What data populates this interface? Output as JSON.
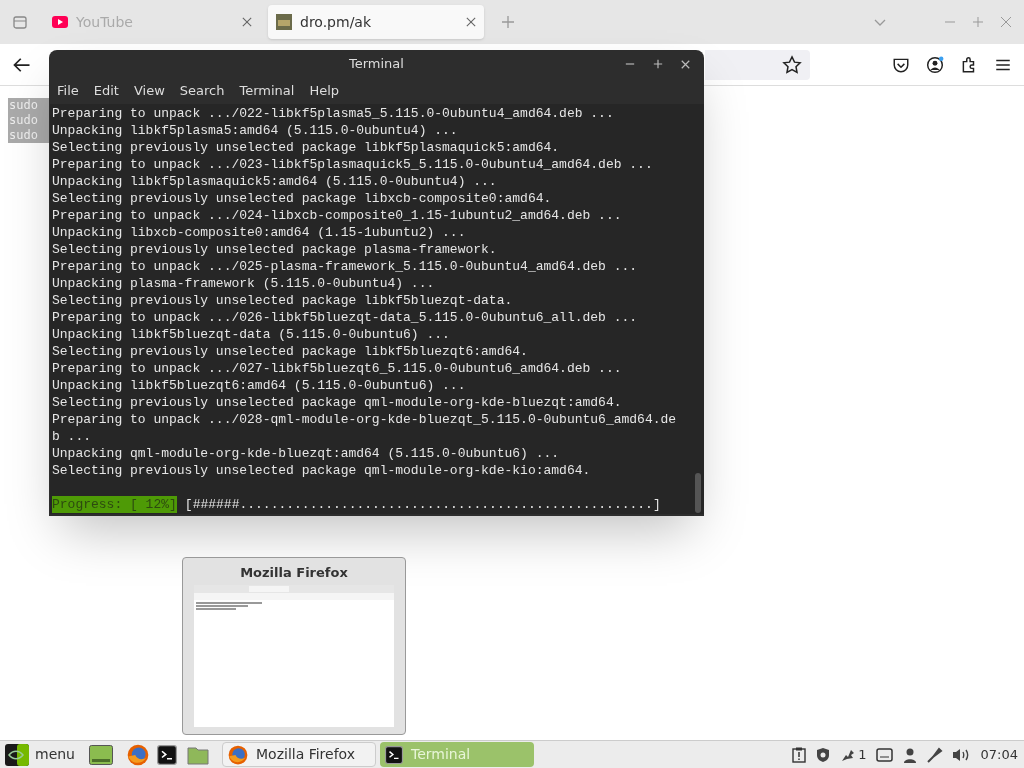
{
  "browser": {
    "tabs": [
      {
        "label": "YouTube",
        "selected": false
      },
      {
        "label": "dro.pm/ak",
        "selected": true
      }
    ],
    "page_lines": [
      "sudo",
      "sudo",
      "sudo"
    ]
  },
  "terminal": {
    "title": "Terminal",
    "menu": [
      "File",
      "Edit",
      "View",
      "Search",
      "Terminal",
      "Help"
    ],
    "lines": [
      "Preparing to unpack .../022-libkf5plasma5_5.115.0-0ubuntu4_amd64.deb ...",
      "Unpacking libkf5plasma5:amd64 (5.115.0-0ubuntu4) ...",
      "Selecting previously unselected package libkf5plasmaquick5:amd64.",
      "Preparing to unpack .../023-libkf5plasmaquick5_5.115.0-0ubuntu4_amd64.deb ...",
      "Unpacking libkf5plasmaquick5:amd64 (5.115.0-0ubuntu4) ...",
      "Selecting previously unselected package libxcb-composite0:amd64.",
      "Preparing to unpack .../024-libxcb-composite0_1.15-1ubuntu2_amd64.deb ...",
      "Unpacking libxcb-composite0:amd64 (1.15-1ubuntu2) ...",
      "Selecting previously unselected package plasma-framework.",
      "Preparing to unpack .../025-plasma-framework_5.115.0-0ubuntu4_amd64.deb ...",
      "Unpacking plasma-framework (5.115.0-0ubuntu4) ...",
      "Selecting previously unselected package libkf5bluezqt-data.",
      "Preparing to unpack .../026-libkf5bluezqt-data_5.115.0-0ubuntu6_all.deb ...",
      "Unpacking libkf5bluezqt-data (5.115.0-0ubuntu6) ...",
      "Selecting previously unselected package libkf5bluezqt6:amd64.",
      "Preparing to unpack .../027-libkf5bluezqt6_5.115.0-0ubuntu6_amd64.deb ...",
      "Unpacking libkf5bluezqt6:amd64 (5.115.0-0ubuntu6) ...",
      "Selecting previously unselected package qml-module-org-kde-bluezqt:amd64.",
      "Preparing to unpack .../028-qml-module-org-kde-bluezqt_5.115.0-0ubuntu6_amd64.de",
      "b ...",
      "Unpacking qml-module-org-kde-bluezqt:amd64 (5.115.0-0ubuntu6) ...",
      "Selecting previously unselected package qml-module-org-kde-kio:amd64."
    ],
    "progress_label": "Progress: [ 12%]",
    "progress_bar": "[######.....................................................]"
  },
  "preview": {
    "title": "Mozilla Firefox"
  },
  "taskbar": {
    "menu_label": "menu",
    "windows": [
      {
        "kind": "firefox",
        "label": "Mozilla Firefox",
        "selected": false
      },
      {
        "kind": "terminal",
        "label": "Terminal",
        "selected": true
      }
    ],
    "notification_count": "1",
    "clock": "07:04"
  }
}
